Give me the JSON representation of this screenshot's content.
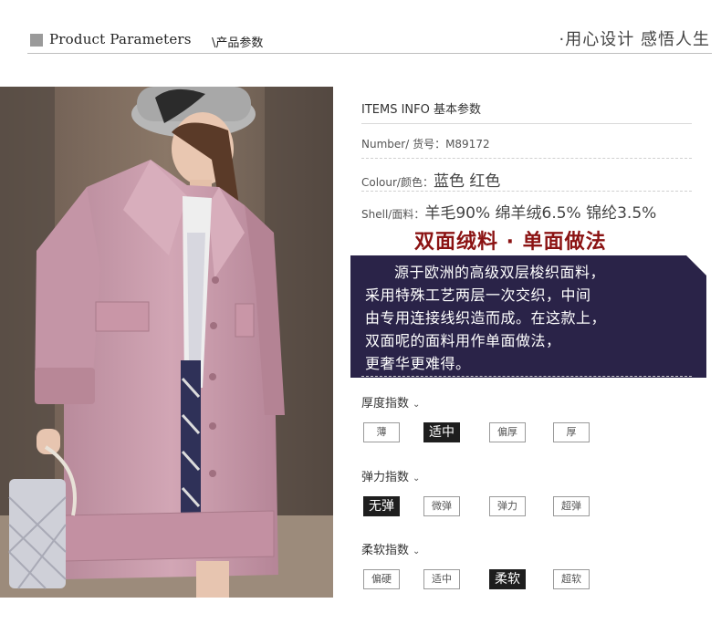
{
  "header": {
    "title": "Product Parameters",
    "subtitle": "\\产品参数",
    "slogan": "·用心设计 感悟人生"
  },
  "info": {
    "heading": "ITEMS INFO 基本参数",
    "number_label": "Number/ 货号：M89172",
    "colour_label": "Colour/颜色：",
    "colour_value": "蓝色  红色",
    "shell_label": "Shell/面料：",
    "shell_value": "羊毛90%  绵羊绒6.5% 锦纶3.5%"
  },
  "feature": {
    "headline": "双面绒料 · 单面做法",
    "lines": [
      "源于欧洲的高级双层梭织面料，",
      "采用特殊工艺两层一次交织，中间",
      "由专用连接线织造而成。在这款上，",
      "双面呢的面料用作单面做法，",
      "更奢华更难得。"
    ]
  },
  "indices": [
    {
      "title": "厚度指数",
      "options": [
        "薄",
        "适中",
        "偏厚",
        "厚"
      ],
      "selected": 1
    },
    {
      "title": "弹力指数",
      "options": [
        "无弹",
        "微弹",
        "弹力",
        "超弹"
      ],
      "selected": 0
    },
    {
      "title": "柔软指数",
      "options": [
        "偏硬",
        "适中",
        "柔软",
        "超软"
      ],
      "selected": 2
    }
  ],
  "colors": {
    "feature_bg": "#2a2348",
    "headline": "#8b1313",
    "coat": "#c89aaa"
  }
}
